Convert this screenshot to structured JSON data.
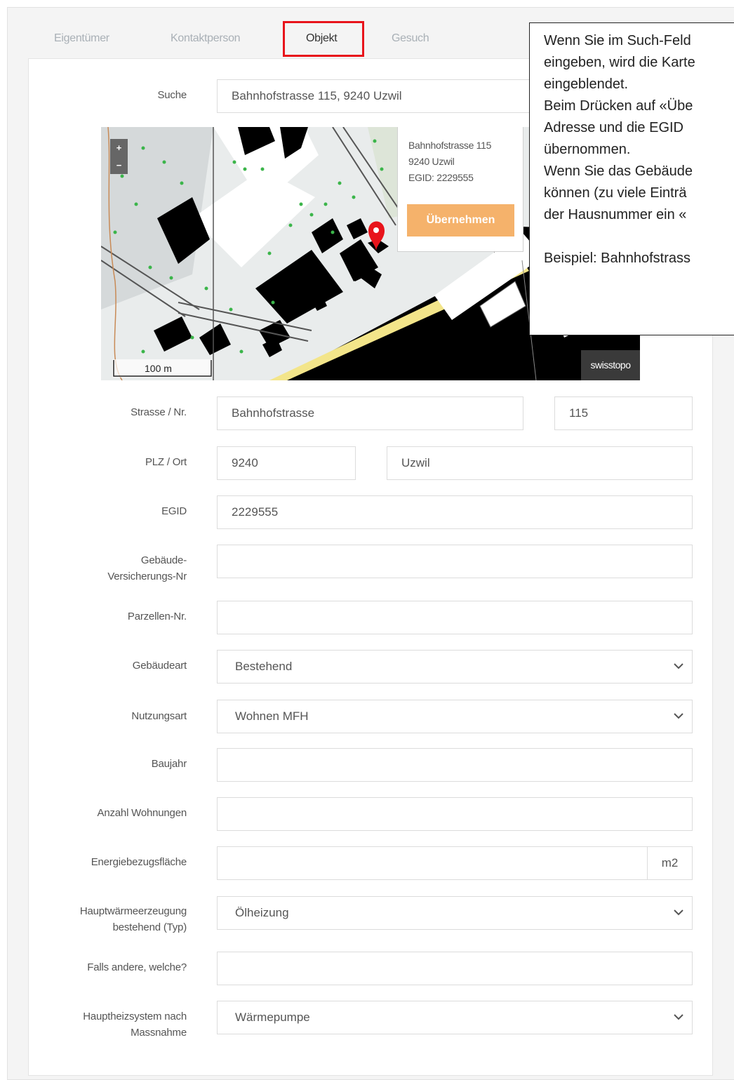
{
  "tabs": [
    {
      "label": "Eigentümer",
      "active": false
    },
    {
      "label": "Kontaktperson",
      "active": false
    },
    {
      "label": "Objekt",
      "active": true
    },
    {
      "label": "Gesuch",
      "active": false
    }
  ],
  "search": {
    "label": "Suche",
    "value": "Bahnhofstrasse 115, 9240 Uzwil"
  },
  "map": {
    "zoom_in": "+",
    "zoom_out": "−",
    "scale": "100 m",
    "attribution": "swisstopo",
    "popup": {
      "line1": "Bahnhofstrasse 115",
      "line2": "9240 Uzwil",
      "line3": "EGID: 2229555",
      "button": "Übernehmen"
    }
  },
  "form": {
    "street": {
      "label": "Strasse / Nr.",
      "value": "Bahnhofstrasse",
      "number": "115"
    },
    "plz": {
      "label": "PLZ / Ort",
      "value": "9240",
      "city": "Uzwil"
    },
    "egid": {
      "label": "EGID",
      "value": "2229555"
    },
    "insurance": {
      "label_line1": "Gebäude-",
      "label_line2": "Versicherungs-Nr",
      "value": ""
    },
    "parcel": {
      "label": "Parzellen-Nr.",
      "value": ""
    },
    "building_type": {
      "label": "Gebäudeart",
      "value": "Bestehend"
    },
    "usage": {
      "label": "Nutzungsart",
      "value": "Wohnen MFH"
    },
    "year": {
      "label": "Baujahr",
      "value": ""
    },
    "apartments": {
      "label": "Anzahl Wohnungen",
      "value": ""
    },
    "energy_area": {
      "label": "Energiebezugsfläche",
      "value": "",
      "unit": "m2"
    },
    "heat_gen": {
      "label_line1": "Hauptwärmeerzeugung",
      "label_line2": "bestehend (Typ)",
      "value": "Ölheizung"
    },
    "other": {
      "label": "Falls andere, welche?",
      "value": ""
    },
    "heating_after": {
      "label_line1": "Hauptheizsystem nach",
      "label_line2": "Massnahme",
      "value": "Wärmepumpe"
    }
  },
  "callout": {
    "lines": [
      "Wenn Sie im Such-Feld",
      "eingeben, wird die Karte",
      "eingeblendet.",
      "Beim Drücken auf «Übe",
      "Adresse und die EGID",
      "übernommen.",
      "Wenn Sie das Gebäude",
      "können (zu viele Einträ",
      "der Hausnummer ein «",
      "",
      "Beispiel: Bahnhofstrass"
    ]
  },
  "colors": {
    "highlight": "#e8141b",
    "button": "#f5b26b",
    "pin": "#e8141b"
  }
}
